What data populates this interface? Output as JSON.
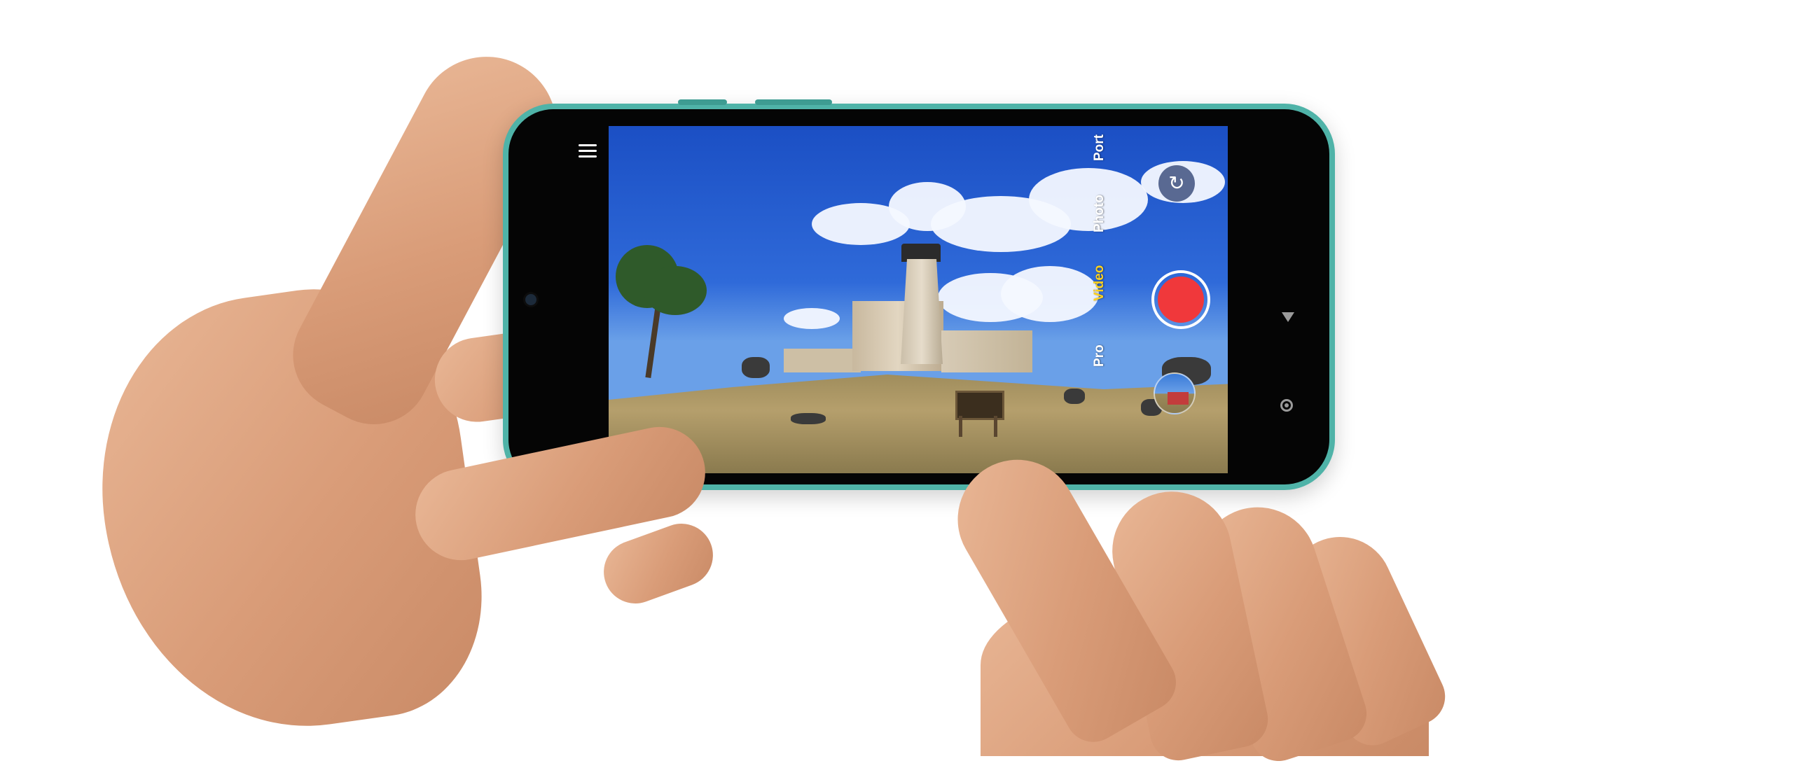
{
  "camera_app": {
    "menu_icon": "hamburger-menu-icon",
    "flash_icon": "flash-off-icon",
    "switch_camera_icon": "switch-camera-icon",
    "modes": [
      {
        "label": "Port",
        "active": false
      },
      {
        "label": "Photo",
        "active": false
      },
      {
        "label": "Video",
        "active": true
      },
      {
        "label": "Pro",
        "active": false
      }
    ],
    "record_color": "#f0383b",
    "active_mode_color": "#ffd21f",
    "status_dot_color": "#3ddc84"
  },
  "navigation": {
    "back_icon": "back-triangle-icon",
    "home_icon": "home-circle-icon"
  },
  "device": {
    "frame_color": "#4fb3a8"
  }
}
